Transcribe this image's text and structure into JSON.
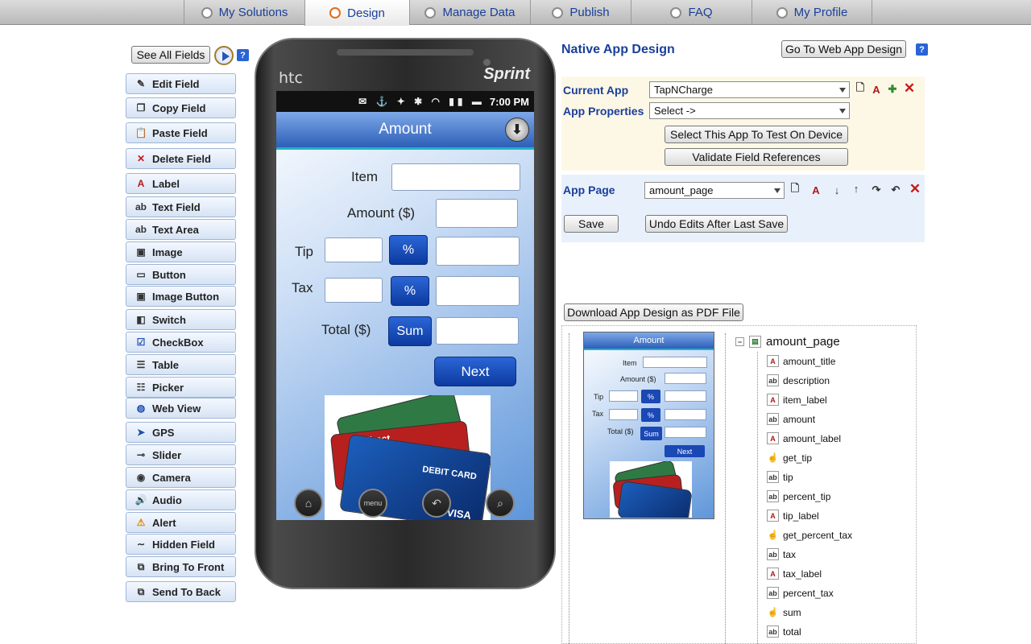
{
  "nav": {
    "tabs": [
      {
        "label": "My Solutions"
      },
      {
        "label": "Design"
      },
      {
        "label": "Manage Data"
      },
      {
        "label": "Publish"
      },
      {
        "label": "FAQ"
      },
      {
        "label": "My Profile"
      }
    ]
  },
  "toolbox": {
    "see_all": "See All Fields",
    "help": "?",
    "items": [
      {
        "label": "Edit Field",
        "icon": "pencil-icon",
        "glyph": "✎"
      },
      {
        "label": "Copy Field",
        "icon": "copy-icon",
        "glyph": "❐"
      },
      {
        "label": "Paste Field",
        "icon": "paste-icon",
        "glyph": "📋"
      },
      {
        "label": "Delete Field",
        "icon": "delete-icon",
        "glyph": "✕"
      },
      {
        "label": "Label",
        "icon": "label-icon",
        "glyph": "A"
      },
      {
        "label": "Text Field",
        "icon": "text-field-icon",
        "glyph": "ab"
      },
      {
        "label": "Text Area",
        "icon": "text-area-icon",
        "glyph": "ab"
      },
      {
        "label": "Image",
        "icon": "image-icon",
        "glyph": "▣"
      },
      {
        "label": "Button",
        "icon": "button-icon",
        "glyph": "▭"
      },
      {
        "label": "Image Button",
        "icon": "image-button-icon",
        "glyph": "▣"
      },
      {
        "label": "Switch",
        "icon": "switch-icon",
        "glyph": "◧"
      },
      {
        "label": "CheckBox",
        "icon": "checkbox-icon",
        "glyph": "☑"
      },
      {
        "label": "Table",
        "icon": "table-icon",
        "glyph": "☰"
      },
      {
        "label": "Picker",
        "icon": "picker-icon",
        "glyph": "☷"
      },
      {
        "label": "Web View",
        "icon": "globe-icon",
        "glyph": "◍"
      },
      {
        "label": "GPS",
        "icon": "gps-icon",
        "glyph": "➤"
      },
      {
        "label": "Slider",
        "icon": "slider-icon",
        "glyph": "⊸"
      },
      {
        "label": "Camera",
        "icon": "camera-icon",
        "glyph": "◉"
      },
      {
        "label": "Audio",
        "icon": "speaker-icon",
        "glyph": "🔊"
      },
      {
        "label": "Alert",
        "icon": "alert-icon",
        "glyph": "⚠"
      },
      {
        "label": "Hidden Field",
        "icon": "tilde-icon",
        "glyph": "∼"
      },
      {
        "label": "Bring To Front",
        "icon": "bring-front-icon",
        "glyph": "⧉"
      },
      {
        "label": "Send To Back",
        "icon": "send-back-icon",
        "glyph": "⧉"
      }
    ]
  },
  "phone": {
    "brand_left": "htc",
    "brand_right": "Sprint",
    "time": "7:00 PM",
    "screen_title": "Amount",
    "item_label": "Item",
    "amount_label": "Amount ($)",
    "tip_label": "Tip",
    "tax_label": "Tax",
    "total_label": "Total ($)",
    "percent_button": "%",
    "sum_button": "Sum",
    "next_button": "Next",
    "card_text_1": "direct",
    "card_text_2": "DEBIT CARD",
    "card_text_3": "VISA",
    "menu_label": "menu"
  },
  "design": {
    "title": "Native App Design",
    "web_design_button": "Go To Web App Design",
    "current_app_label": "Current App",
    "current_app_value": "TapNCharge",
    "app_properties_label": "App Properties",
    "app_properties_value": "Select ->",
    "test_button": "Select This App To Test On Device",
    "validate_button": "Validate Field References",
    "app_page_label": "App Page",
    "app_page_value": "amount_page",
    "save_button": "Save",
    "undo_button": "Undo Edits After Last Save",
    "pdf_button": "Download App Design as PDF File"
  },
  "preview": {
    "title": "Amount",
    "item": "Item",
    "amount": "Amount ($)",
    "tip": "Tip",
    "tax": "Tax",
    "total": "Total ($)",
    "percent": "%",
    "sum": "Sum",
    "next": "Next"
  },
  "tree": {
    "root": "amount_page",
    "items": [
      {
        "name": "amount_title",
        "kind": "label"
      },
      {
        "name": "description",
        "kind": "text"
      },
      {
        "name": "item_label",
        "kind": "label"
      },
      {
        "name": "amount",
        "kind": "text"
      },
      {
        "name": "amount_label",
        "kind": "label"
      },
      {
        "name": "get_tip",
        "kind": "button"
      },
      {
        "name": "tip",
        "kind": "text"
      },
      {
        "name": "percent_tip",
        "kind": "text"
      },
      {
        "name": "tip_label",
        "kind": "label"
      },
      {
        "name": "get_percent_tax",
        "kind": "button"
      },
      {
        "name": "tax",
        "kind": "text"
      },
      {
        "name": "tax_label",
        "kind": "label"
      },
      {
        "name": "percent_tax",
        "kind": "text"
      },
      {
        "name": "sum",
        "kind": "button"
      },
      {
        "name": "total",
        "kind": "text"
      }
    ]
  }
}
